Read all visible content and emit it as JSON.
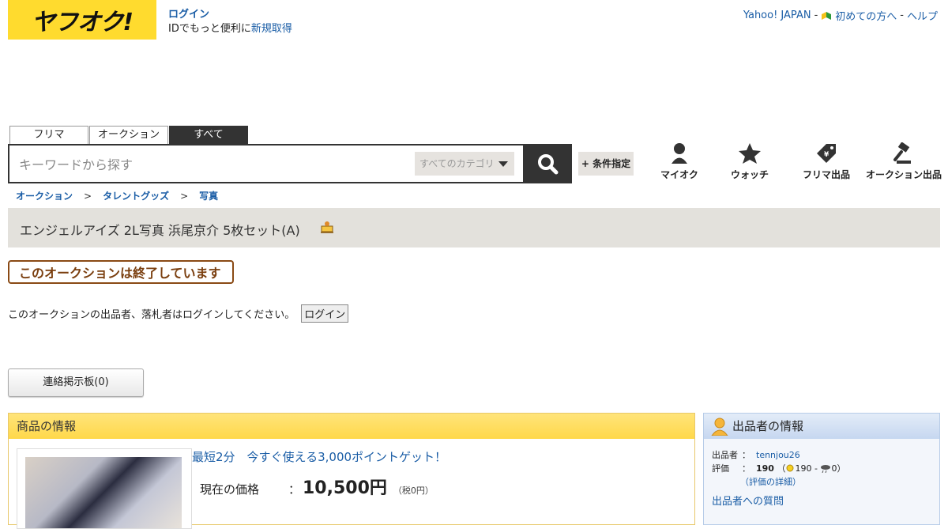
{
  "header": {
    "logo_text": "ヤフオク!",
    "login_link": "ログイン",
    "id_text": "IDでもっと便利に",
    "signup_link": "新規取得",
    "yahoo_link": "Yahoo! JAPAN",
    "sep1": "-",
    "first_time_link": "初めての方へ",
    "sep2": "-",
    "help_link": "ヘルプ"
  },
  "search": {
    "tabs": [
      "フリマ",
      "オークション",
      "すべて"
    ],
    "active_tab": "すべて",
    "placeholder": "キーワードから探す",
    "category": "すべてのカテゴリ",
    "condition_label": "+ 条件指定"
  },
  "nav": {
    "my_auction": "マイオク",
    "watch": "ウォッチ",
    "flea_listing": "フリマ出品",
    "auction_listing": "オークション出品"
  },
  "breadcrumb": {
    "items": [
      "オークション",
      "タレントグッズ",
      "写真"
    ],
    "separator": ">"
  },
  "item": {
    "title": "エンジェルアイズ 2L写真 浜尾京介 5枚セット(A)",
    "ended_label": "このオークションは終了しています",
    "login_note": "このオークションの出品者、落札者はログインしてください。",
    "login_button": "ログイン",
    "board_button": "連絡掲示板(0)"
  },
  "product_info": {
    "heading": "商品の情報",
    "promo": "最短2分　今すぐ使える3,000ポイントゲット！",
    "price_label": "現在の価格",
    "colon": "：",
    "price": "10,500円",
    "tax": "（税0円）"
  },
  "seller": {
    "heading": "出品者の情報",
    "seller_label": "出品者",
    "seller_name": "tennjou26",
    "rating_label": "評価",
    "colon": "：",
    "rating_total": "190",
    "rating_open": "（",
    "rating_good": "190",
    "rating_dash": "-",
    "rating_bad": "0",
    "rating_close": "）",
    "rating_detail": "（評価の詳細）",
    "more_links": "出品者への質問"
  }
}
